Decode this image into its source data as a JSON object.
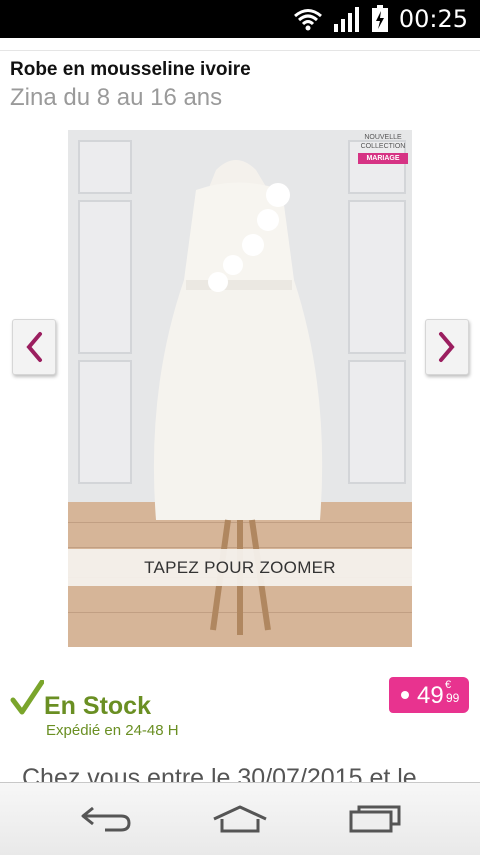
{
  "status_bar": {
    "time": "00:25"
  },
  "product": {
    "title": "Robe en mousseline ivoire",
    "subtitle": "Zina du 8 au 16 ans"
  },
  "image": {
    "badge_line1": "NOUVELLE",
    "badge_line2": "COLLECTION",
    "badge_line3": "MARIAGE",
    "zoom_label": "TAPEZ POUR ZOOMER"
  },
  "availability": {
    "status": "En Stock",
    "shipping": "Expédié en 24-48 H"
  },
  "price": {
    "integer": "49",
    "currency": "€",
    "cents": "99"
  },
  "delivery_text": "Chez vous entre le 30/07/2015 et le",
  "colors": {
    "accent_pink": "#e8338f",
    "stock_green": "#6a8f23",
    "arrow_purple": "#9b1e5f"
  },
  "icons": {
    "wifi": "wifi-icon",
    "signal": "signal-icon",
    "battery": "battery-charging-icon",
    "prev": "chevron-left-icon",
    "next": "chevron-right-icon",
    "check": "checkmark-icon",
    "back": "back-icon",
    "home": "home-icon",
    "recent": "recent-apps-icon"
  }
}
